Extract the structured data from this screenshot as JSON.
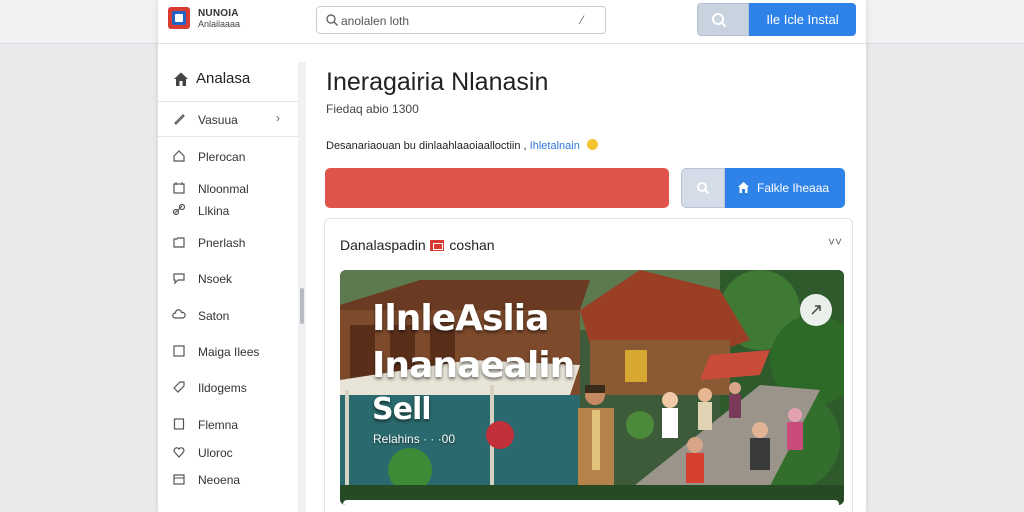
{
  "app": {
    "brand_line1": "NUNOIA",
    "brand_line2": "Anlailaaaa"
  },
  "header": {
    "search_placeholder": "anolalen loth",
    "search_end": "⁄",
    "install_label": "Ile Icle Instal"
  },
  "sidebar": {
    "head_label": "Analasa",
    "items": [
      {
        "label": "Vasuua",
        "icon": "chat-icon"
      },
      {
        "label": "Plerocan",
        "icon": "home-icon"
      },
      {
        "label": "Nloonmal",
        "icon": "calendar-icon"
      },
      {
        "label": "Llkina",
        "icon": "link-icon"
      },
      {
        "label": "Pnerlash",
        "icon": "folder-icon"
      },
      {
        "label": "Nsoek",
        "icon": "chat-bubble-icon"
      },
      {
        "label": "Saton",
        "icon": "cloud-icon"
      },
      {
        "label": "Maiga Ilees",
        "icon": "square-icon"
      },
      {
        "label": "Ildogems",
        "icon": "tag-icon"
      },
      {
        "label": "Flemna",
        "icon": "file-icon"
      },
      {
        "label": "Uloroc",
        "icon": "heart-icon"
      },
      {
        "label": "Neoena",
        "icon": "box-icon"
      }
    ]
  },
  "main": {
    "title": "Ineragairia Nlanasin",
    "subtitle": "Fiedaq abio 1300",
    "description": "Desanariaouan bu dinlaahlaaoiaalloctiin ,",
    "description_link": "Ihletalnain",
    "action_button_label": "Falkle Iheaaa"
  },
  "card": {
    "title_prefix": "Danalaspadin",
    "title_suffix": "coshan",
    "menu_glyph": "˅˅",
    "hero_line1": "IlnleAslia",
    "hero_line2": "Inanaealin",
    "hero_line3": "Sell",
    "hero_caption": "Relahins · · ·00"
  },
  "colors": {
    "accent_blue": "#2f83e8",
    "red_bar": "#e0554b",
    "link": "#2f77d8"
  }
}
